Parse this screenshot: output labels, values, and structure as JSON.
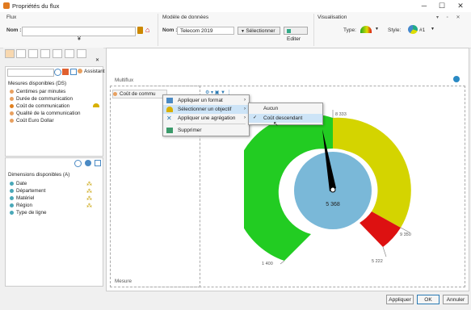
{
  "window": {
    "title": "Propriétés du flux",
    "minimize": "─",
    "maximize": "☐",
    "close": "✕"
  },
  "ribbon": {
    "flux_label": "Flux",
    "name_label": "Nom :",
    "model_label": "Modèle de données",
    "model_name_label": "Nom :",
    "model_value": "Telecom 2019",
    "select_button": "Sélectionner",
    "edit_button": "Editer",
    "visual_label": "Visualisation",
    "type_label": "Type:",
    "style_label": "Style:",
    "style_value": "#1",
    "collapse_glyph": "¥"
  },
  "left_panel": {
    "assistant": "Assistant",
    "measures_header": "Mesures disponibles (DS)",
    "measures": [
      "Centimes par minutes",
      "Durée de communication",
      "Coût de communication",
      "Qualité de la communication",
      "Coût Euro Dollar"
    ],
    "dimensions_header": "Dimensions disponibles (A)",
    "dimensions": [
      "Date",
      "Département",
      "Matériel",
      "Région",
      "Type de ligne"
    ]
  },
  "main": {
    "multiflux_label": "Multiflux",
    "measure_label": "Mesure",
    "chip_label": "Coût de commu"
  },
  "context_menu": {
    "items": [
      "Appliquer un format",
      "Sélectionner un objectif",
      "Appliquer une agrégation",
      "Supprimer"
    ],
    "submenu": [
      "Aucun",
      "Coût descendant"
    ]
  },
  "chart_data": {
    "type": "gauge",
    "value_label": "5 368",
    "tick_labels": [
      "8 333",
      "1 400",
      "9 350",
      "5 222"
    ],
    "colors": {
      "green": "#22cc22",
      "yellow": "#d4d400",
      "red": "#dd1111",
      "center": "#7ab8d8"
    }
  },
  "footer": {
    "apply": "Appliquer",
    "ok": "OK",
    "cancel": "Annuler"
  }
}
